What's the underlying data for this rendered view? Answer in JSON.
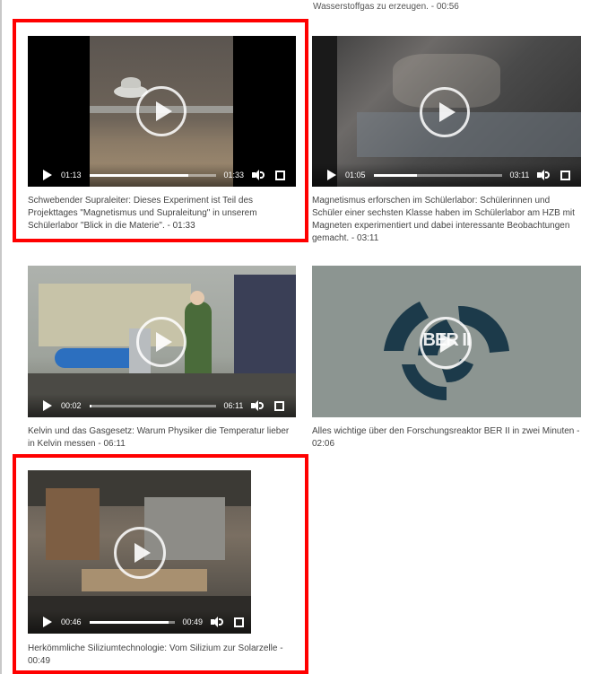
{
  "top_caption": "Wasserstoffgas zu erzeugen. - 00:56",
  "colors": {
    "highlight": "#ff0000",
    "caption_text": "#444444",
    "ber_logo_bg": "#8c9591",
    "ber_logo_fg": "#1c3a4a"
  },
  "videos": [
    {
      "current_time": "01:13",
      "duration": "01:33",
      "progress": 0.78,
      "caption": "Schwebender Supraleiter: Dieses Experiment ist Teil des Projekttages \"Magnetismus und Supraleitung\" in unserem Schülerlabor \"Blick in die Materie\". - 01:33",
      "highlighted": true
    },
    {
      "current_time": "01:05",
      "duration": "03:11",
      "progress": 0.34,
      "caption": "Magnetismus erforschen im Schülerlabor: Schülerinnen und Schüler einer sechsten Klasse haben im Schülerlabor am HZB mit Magneten experimentiert und dabei interessante Beobachtungen gemacht. - 03:11",
      "highlighted": false
    },
    {
      "current_time": "00:02",
      "duration": "06:11",
      "progress": 0.02,
      "caption": "Kelvin und das Gasgesetz: Warum Physiker die Temperatur lieber in Kelvin messen - 06:11",
      "highlighted": false
    },
    {
      "logo_text": "BER II",
      "caption": "Alles wichtige über den Forschungsreaktor BER II in zwei Minuten - 02:06",
      "highlighted": false
    },
    {
      "current_time": "00:46",
      "duration": "00:49",
      "progress": 0.93,
      "caption": "Herkömmliche Siliziumtechnologie: Vom Silizium zur Solarzelle - 00:49",
      "highlighted": true
    }
  ]
}
